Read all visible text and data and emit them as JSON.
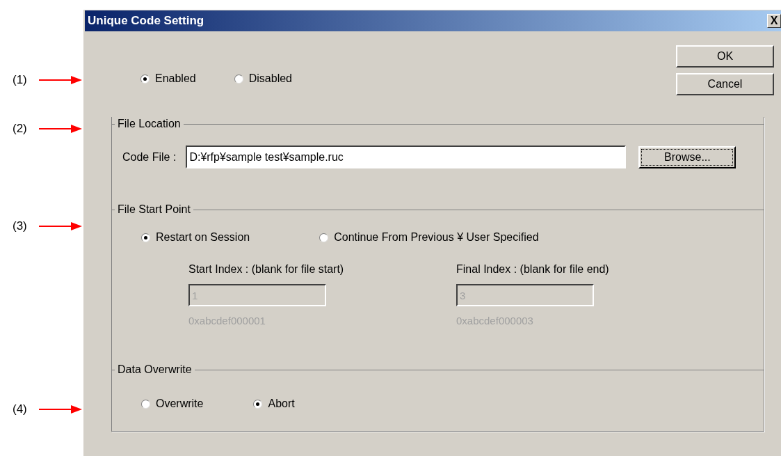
{
  "window": {
    "title": "Unique Code Setting",
    "close": "X"
  },
  "annotations": [
    "(1)",
    "(2)",
    "(3)",
    "(4)"
  ],
  "mode_options": [
    {
      "label": "Enabled",
      "selected": true
    },
    {
      "label": "Disabled",
      "selected": false
    }
  ],
  "buttons": [
    "OK",
    "Cancel"
  ],
  "file_location": {
    "heading": "File Location",
    "label": "Code File :",
    "value": "D:¥rfp¥sample test¥sample.ruc",
    "browse": "Browse..."
  },
  "file_start_point": {
    "heading": "File Start Point",
    "options": [
      {
        "label": "Restart on Session",
        "selected": true
      },
      {
        "label": "Continue From Previous ¥ User Specified",
        "selected": false
      }
    ],
    "indices": [
      {
        "label": "Start Index : (blank for file start)",
        "value": "1",
        "hex": "0xabcdef000001",
        "disabled": true
      },
      {
        "label": "Final Index : (blank for file end)",
        "value": "3",
        "hex": "0xabcdef000003",
        "disabled": true
      }
    ]
  },
  "data_overwrite": {
    "heading": "Data Overwrite",
    "options": [
      {
        "label": "Overwrite",
        "selected": false
      },
      {
        "label": "Abort",
        "selected": true
      }
    ]
  }
}
